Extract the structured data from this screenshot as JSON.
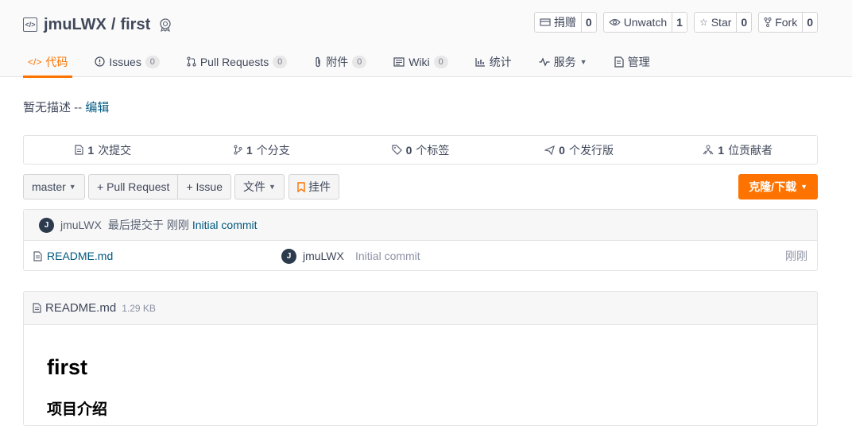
{
  "repo": {
    "owner": "jmuLWX",
    "separator": "/",
    "name": "first"
  },
  "actions": [
    {
      "label": "捐赠",
      "count": "0",
      "icon": "donate-icon"
    },
    {
      "label": "Unwatch",
      "count": "1",
      "icon": "eye-icon"
    },
    {
      "label": "Star",
      "count": "0",
      "icon": "star-icon"
    },
    {
      "label": "Fork",
      "count": "0",
      "icon": "fork-icon"
    }
  ],
  "tabs": [
    {
      "label": "代码",
      "icon": "code-icon",
      "badge": null,
      "active": true
    },
    {
      "label": "Issues",
      "icon": "issue-icon",
      "badge": "0"
    },
    {
      "label": "Pull Requests",
      "icon": "pull-request-icon",
      "badge": "0"
    },
    {
      "label": "附件",
      "icon": "paperclip-icon",
      "badge": "0"
    },
    {
      "label": "Wiki",
      "icon": "wiki-icon",
      "badge": "0"
    },
    {
      "label": "统计",
      "icon": "bar-chart-icon",
      "badge": null
    },
    {
      "label": "服务",
      "icon": "pulse-icon",
      "badge": null,
      "dropdown": true
    },
    {
      "label": "管理",
      "icon": "settings-doc-icon",
      "badge": null
    }
  ],
  "description": {
    "text": "暂无描述 --",
    "edit_label": "编辑"
  },
  "stats": [
    {
      "count": "1",
      "label": "次提交",
      "icon": "commit-icon"
    },
    {
      "count": "1",
      "label": "个分支",
      "icon": "branch-icon"
    },
    {
      "count": "0",
      "label": "个标签",
      "icon": "tag-icon"
    },
    {
      "count": "0",
      "label": "个发行版",
      "icon": "release-icon"
    },
    {
      "count": "1",
      "label": "位贡献者",
      "icon": "contributors-icon"
    }
  ],
  "toolbar": {
    "branch": "master",
    "pull_request": "+ Pull Request",
    "issue": "+ Issue",
    "file": "文件",
    "widget": "挂件",
    "clone": "克隆/下载"
  },
  "last_commit": {
    "avatar_letter": "J",
    "author": "jmuLWX",
    "text": "最后提交于",
    "time": "刚刚",
    "message": "Initial commit"
  },
  "files": [
    {
      "name": "README.md",
      "avatar_letter": "J",
      "author": "jmuLWX",
      "message": "Initial commit",
      "time": "刚刚"
    }
  ],
  "readme": {
    "filename": "README.md",
    "size": "1.29 KB",
    "h1": "first",
    "h3": "项目介绍"
  },
  "colors": {
    "accent": "#fe7300",
    "link": "#005980",
    "text": "#40485b"
  }
}
